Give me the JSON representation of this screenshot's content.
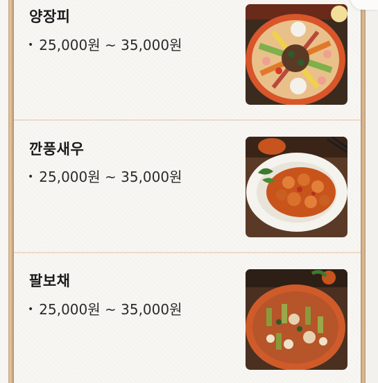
{
  "menu": {
    "items": [
      {
        "name": "양장피",
        "price": "25,000원 ~ 35,000원",
        "bullet": "•",
        "image": "yangjangpi-dish-photo"
      },
      {
        "name": "깐풍새우",
        "price": "25,000원 ~ 35,000원",
        "bullet": "•",
        "image": "kkanpung-shrimp-dish-photo"
      },
      {
        "name": "팔보채",
        "price": "25,000원 ~ 35,000원",
        "bullet": "•",
        "image": "palbochae-dish-photo"
      }
    ]
  },
  "colors": {
    "background": "#f7f6f3",
    "divider": "#eed9c8",
    "frame": "#c7a57e",
    "text": "#1a1a1a"
  }
}
